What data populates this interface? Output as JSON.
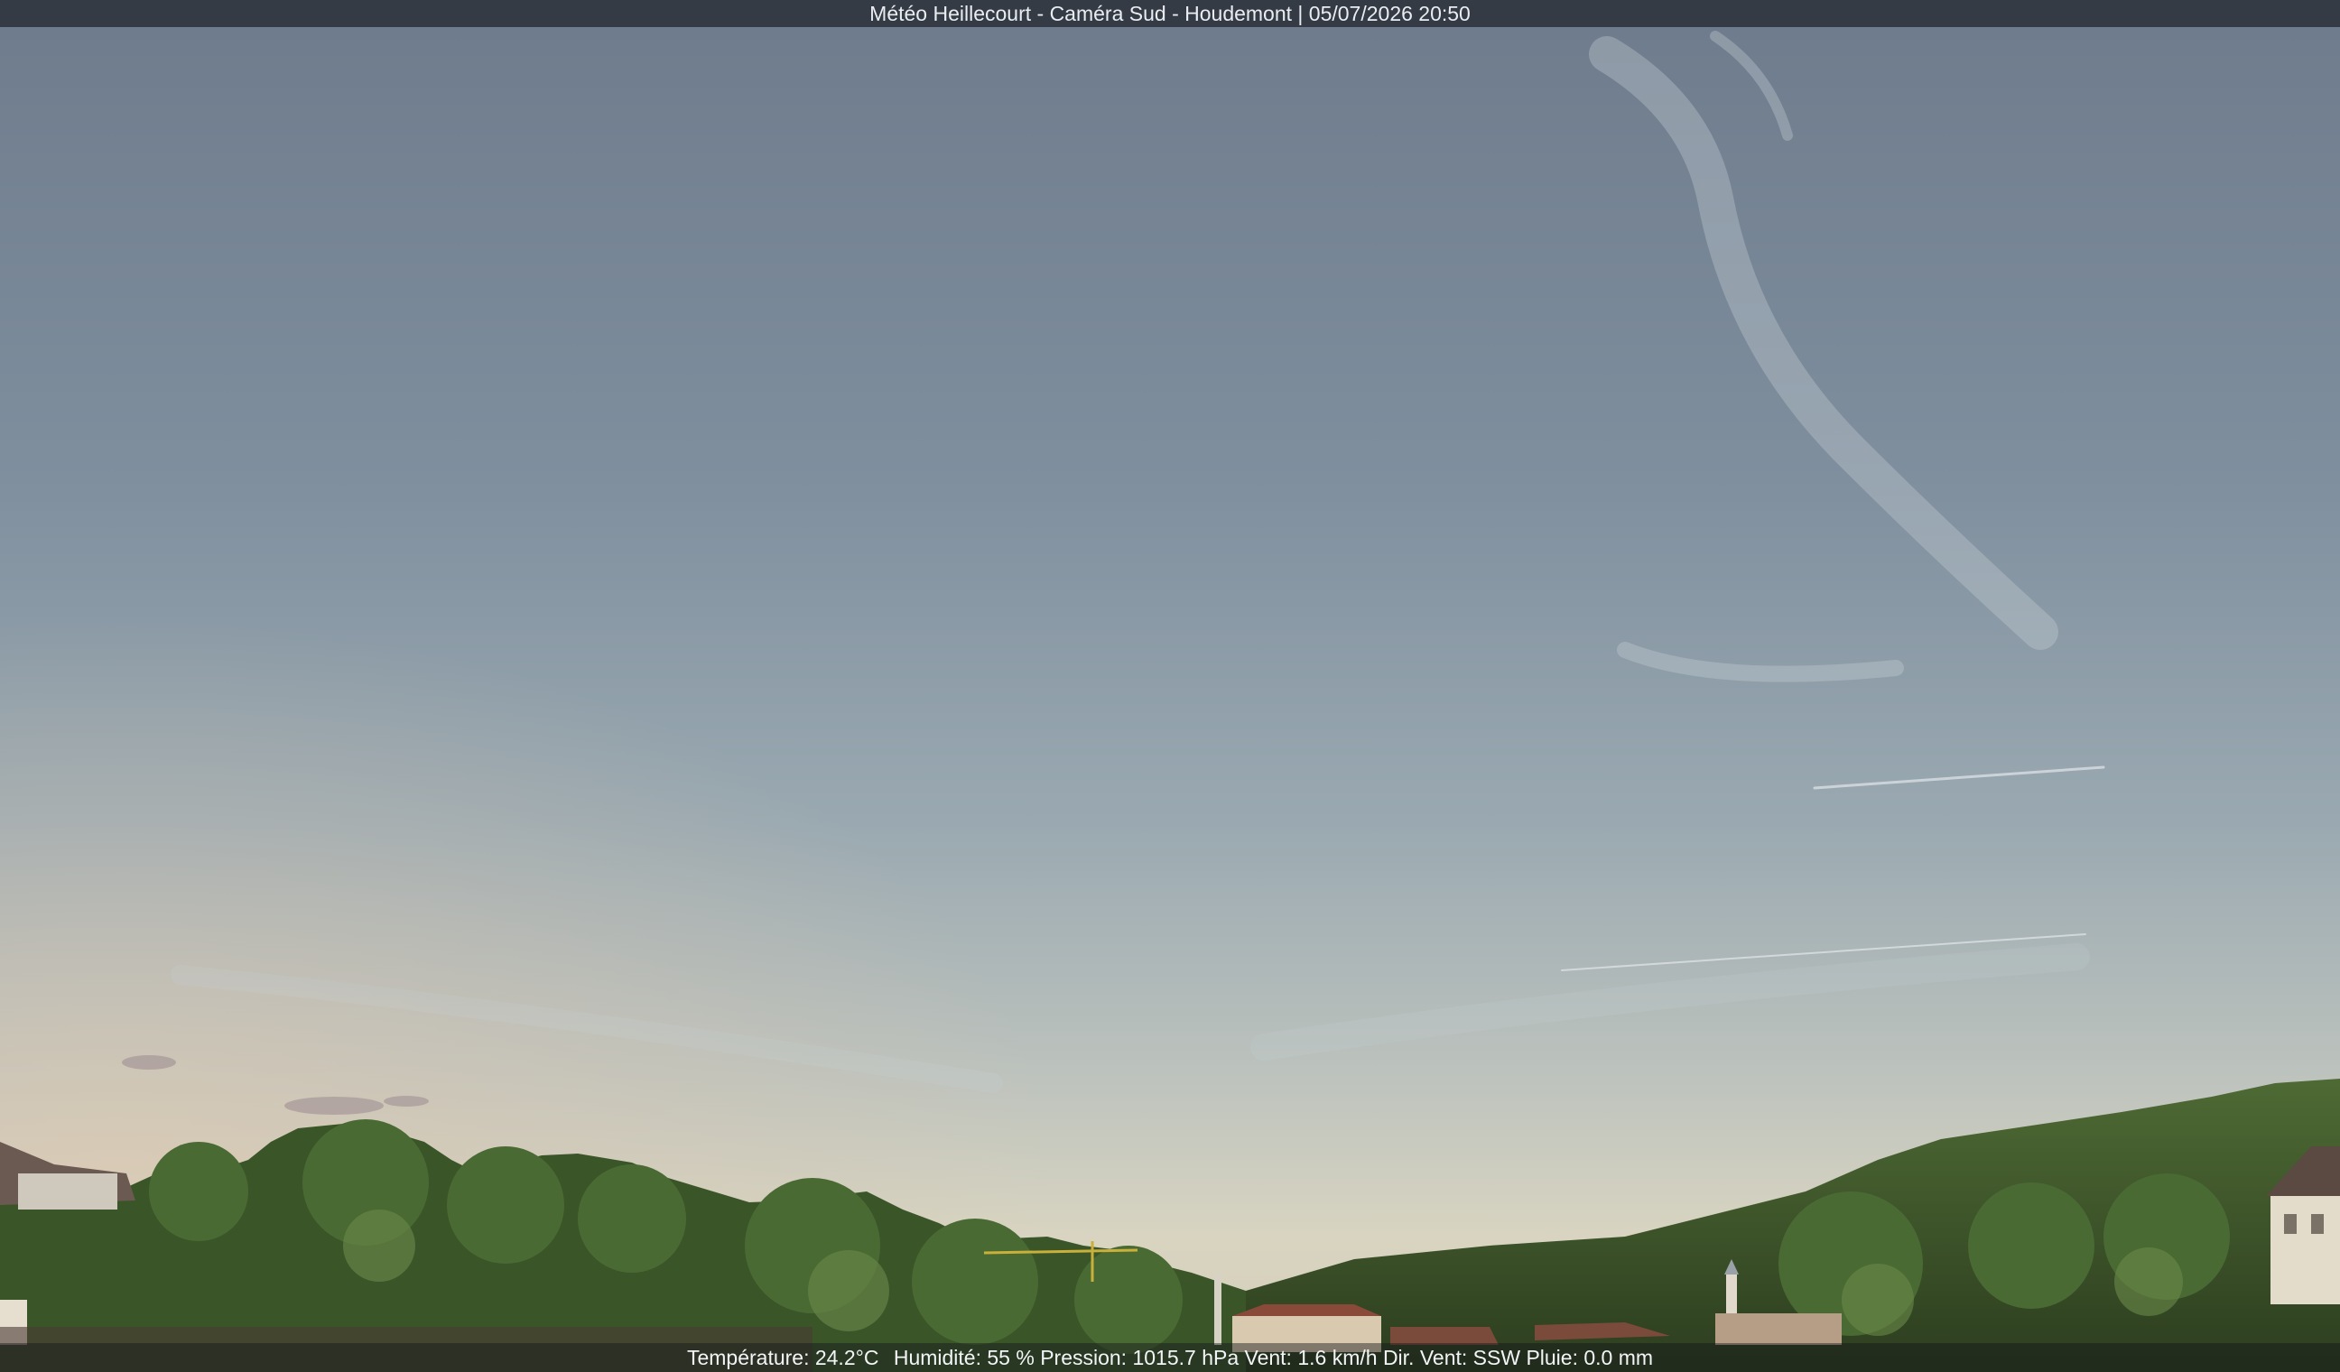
{
  "header": {
    "caption": "Météo Heillecourt - Caméra Sud - Houdemont | 05/07/2026 20:50"
  },
  "weather": {
    "temperature": "Température: 24.2°C",
    "humidity": "Humidité: 55 %",
    "pressure": "Pression: 1015.7 hPa",
    "wind": "Vent: 1.6 km/h",
    "wind_dir": "Dir. Vent: SSW",
    "rain": "Pluie: 0.0 mm"
  },
  "colors": {
    "sky_top": "#6e7d8d",
    "sky_mid": "#8b9aa8",
    "sky_horizon": "#d7d3c2",
    "trees": "#3b5a2a"
  }
}
